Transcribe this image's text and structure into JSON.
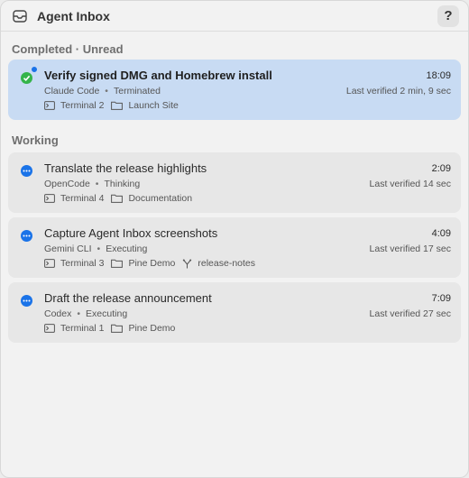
{
  "header": {
    "title": "Agent Inbox",
    "help_label": "?"
  },
  "sections": [
    {
      "title": "Completed · Unread",
      "items": [
        {
          "title": "Verify signed DMG and Homebrew install",
          "time": "18:09",
          "agent": "Claude Code",
          "state": "Terminated",
          "verified": "Last verified 2 min, 9 sec",
          "terminal": "Terminal 2",
          "folder": "Launch Site",
          "branch": ""
        }
      ]
    },
    {
      "title": "Working",
      "items": [
        {
          "title": "Translate the release highlights",
          "time": "2:09",
          "agent": "OpenCode",
          "state": "Thinking",
          "verified": "Last verified 14 sec",
          "terminal": "Terminal 4",
          "folder": "Documentation",
          "branch": ""
        },
        {
          "title": "Capture Agent Inbox screenshots",
          "time": "4:09",
          "agent": "Gemini CLI",
          "state": "Executing",
          "verified": "Last verified 17 sec",
          "terminal": "Terminal 3",
          "folder": "Pine Demo",
          "branch": "release-notes"
        },
        {
          "title": "Draft the release announcement",
          "time": "7:09",
          "agent": "Codex",
          "state": "Executing",
          "verified": "Last verified 27 sec",
          "terminal": "Terminal 1",
          "folder": "Pine Demo",
          "branch": ""
        }
      ]
    }
  ],
  "colors": {
    "accent": "#1a73e8",
    "done": "#34b44a",
    "selected_bg": "#c8dbf3"
  }
}
